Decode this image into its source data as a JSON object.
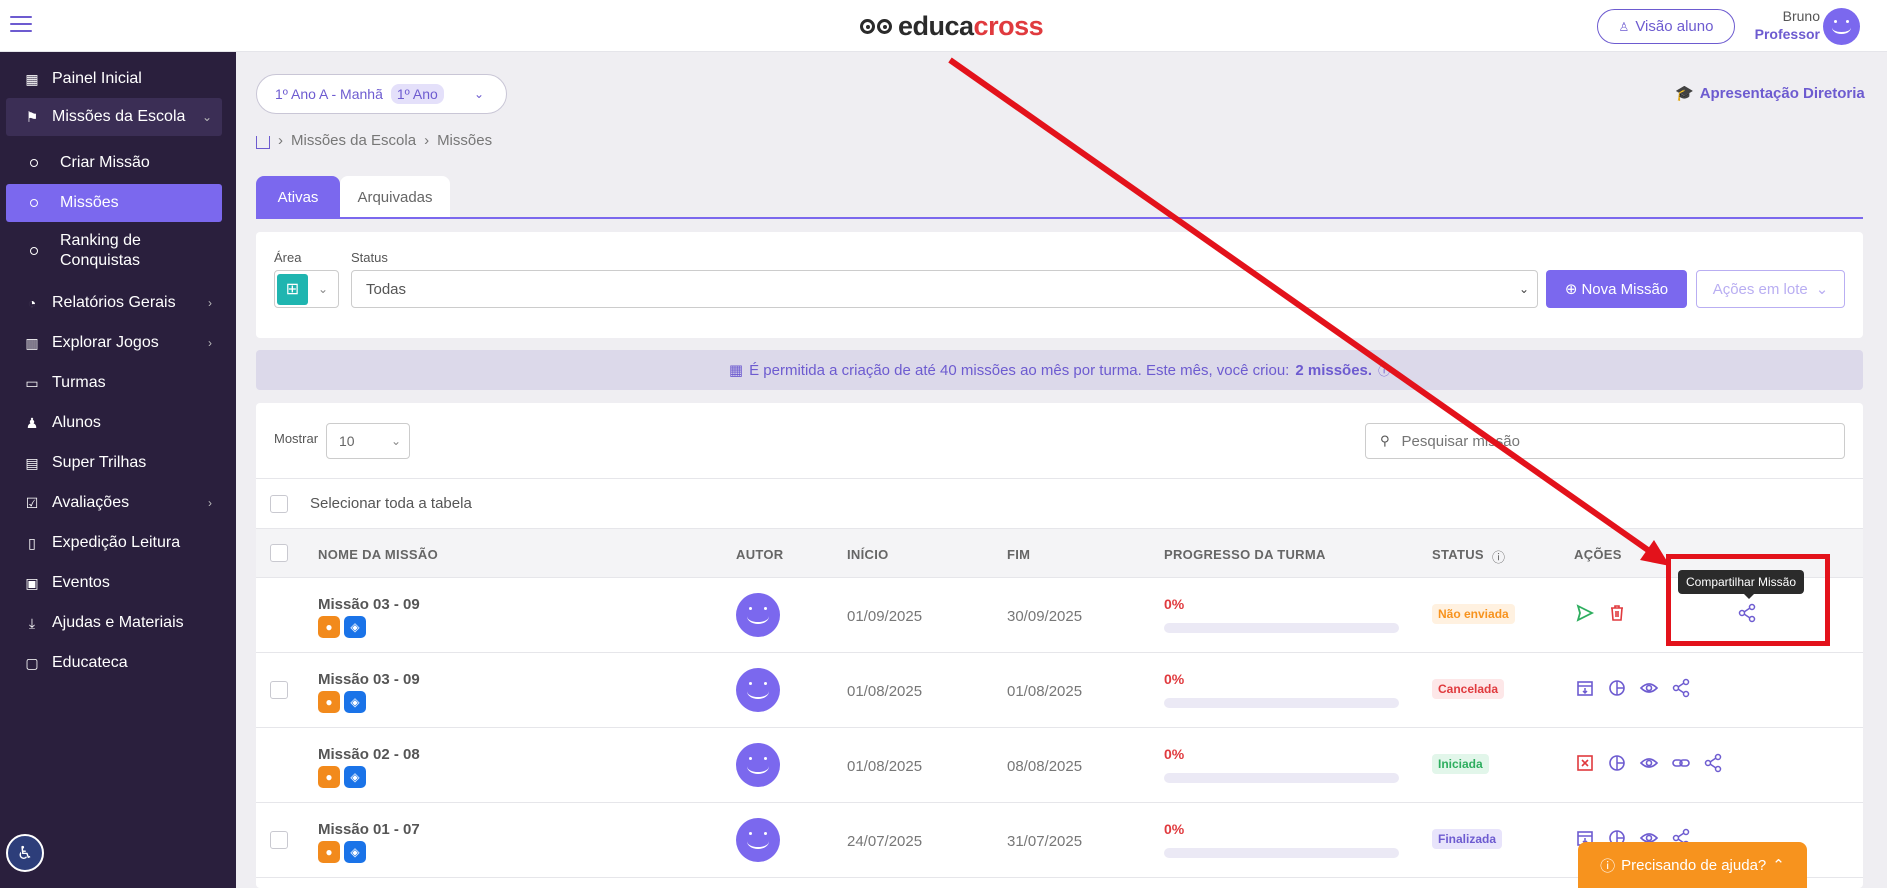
{
  "topbar": {
    "logo_left": "educa",
    "logo_right": "cross",
    "visao_aluno": "Visão aluno",
    "user_name": "Bruno",
    "user_role": "Professor"
  },
  "sidebar": {
    "items": [
      {
        "label": "Painel Inicial",
        "icon": "grid-icon"
      },
      {
        "label": "Missões da Escola",
        "icon": "flag-icon"
      },
      {
        "label": "Criar Missão"
      },
      {
        "label": "Missões"
      },
      {
        "label": "Ranking de Conquistas"
      },
      {
        "label": "Relatórios Gerais",
        "icon": "chart-icon"
      },
      {
        "label": "Explorar Jogos",
        "icon": "map-icon"
      },
      {
        "label": "Turmas",
        "icon": "briefcase-icon"
      },
      {
        "label": "Alunos",
        "icon": "users-icon"
      },
      {
        "label": "Super Trilhas",
        "icon": "book-map-icon"
      },
      {
        "label": "Avaliações",
        "icon": "checklist-icon"
      },
      {
        "label": "Expedição Leitura",
        "icon": "book-icon"
      },
      {
        "label": "Eventos",
        "icon": "calendar-icon"
      },
      {
        "label": "Ajudas e Materiais",
        "icon": "download-icon"
      },
      {
        "label": "Educateca",
        "icon": "screen-icon"
      }
    ]
  },
  "class_selector": {
    "label": "1º Ano A - Manhã",
    "pill": "1º Ano"
  },
  "apresentacao": "Apresentação Diretoria",
  "breadcrumb": [
    "Missões da Escola",
    "Missões"
  ],
  "tabs": {
    "active": "Ativas",
    "archived": "Arquivadas"
  },
  "filters": {
    "area_label": "Área",
    "status_label": "Status",
    "status_value": "Todas",
    "nova_missao": "Nova Missão",
    "acoes_lote": "Ações em lote"
  },
  "info": {
    "text": "É permitida a criação de até 40 missões ao mês por turma. Este mês, você criou:",
    "count": "2 missões."
  },
  "table": {
    "mostrar_label": "Mostrar",
    "mostrar_value": "10",
    "search_placeholder": "Pesquisar missão",
    "select_all": "Selecionar toda a tabela",
    "headers": {
      "nome": "NOME DA MISSÃO",
      "autor": "AUTOR",
      "inicio": "INÍCIO",
      "fim": "FIM",
      "progresso": "PROGRESSO DA TURMA",
      "status": "STATUS",
      "acoes": "AÇÕES"
    },
    "rows": [
      {
        "name": "Missão 03 - 09",
        "inicio": "01/09/2025",
        "fim": "30/09/2025",
        "progress_text": "0%",
        "progress": 0,
        "status": "Não enviada",
        "status_color": "#f7931e",
        "status_bg": "#fff1e0"
      },
      {
        "name": "Missão 03 - 09",
        "inicio": "01/08/2025",
        "fim": "01/08/2025",
        "progress_text": "0%",
        "progress": 0,
        "status": "Cancelada",
        "status_color": "#e03a3e",
        "status_bg": "#fde7e8"
      },
      {
        "name": "Missão 02 - 08",
        "inicio": "01/08/2025",
        "fim": "08/08/2025",
        "progress_text": "0%",
        "progress": 0,
        "status": "Iniciada",
        "status_color": "#2eae5f",
        "status_bg": "#e2f6ea"
      },
      {
        "name": "Missão 01 - 07",
        "inicio": "24/07/2025",
        "fim": "31/07/2025",
        "progress_text": "0%",
        "progress": 0,
        "status": "Finalizada",
        "status_color": "#6d5bd0",
        "status_bg": "#e8e4fb"
      }
    ]
  },
  "tooltip": "Compartilhar Missão",
  "help_button": "Precisando de ajuda?",
  "colors": {
    "accent": "#7b68ee",
    "sidebar": "#2a1f3d",
    "annotation": "#e3121b"
  }
}
